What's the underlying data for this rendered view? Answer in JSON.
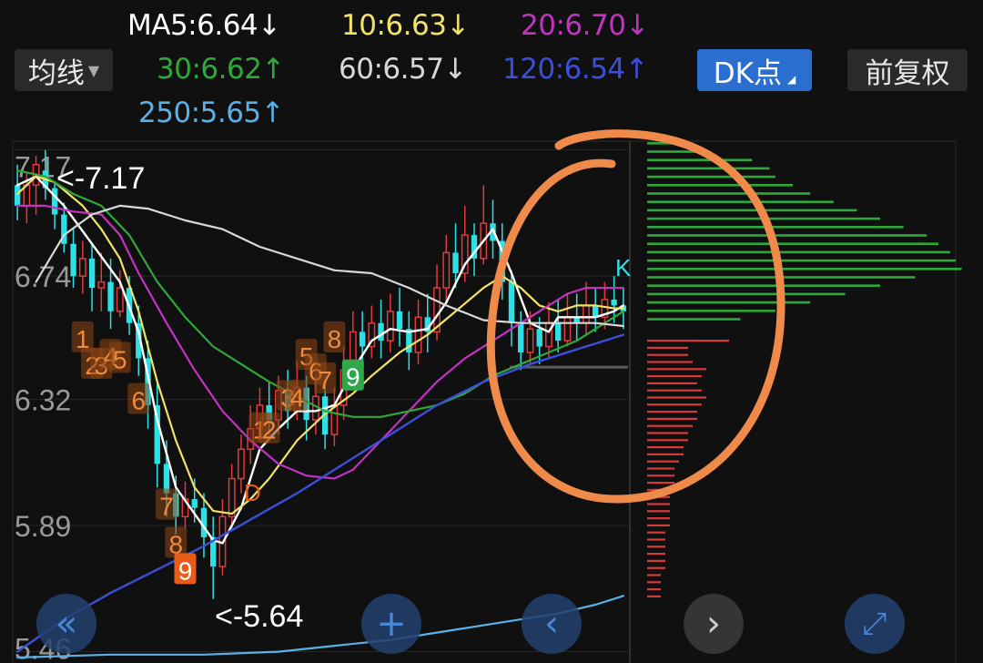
{
  "header": {
    "ma_button": "均线",
    "dk_button": "DK点",
    "fq_button": "前复权",
    "ma_items": [
      {
        "text": "MA5:6.64↓",
        "color": "#ffffff"
      },
      {
        "text": "10:6.63↓",
        "color": "#f2e266"
      },
      {
        "text": "20:6.70↓",
        "color": "#c233c2"
      },
      {
        "text": "30:6.62↑",
        "color": "#2ea83a"
      },
      {
        "text": "60:6.57↓",
        "color": "#d8d8d8"
      },
      {
        "text": "120:6.54↑",
        "color": "#3b4fd8"
      },
      {
        "text": "250:5.65↑",
        "color": "#5ab0e8"
      }
    ]
  },
  "chart_data": {
    "type": "candlestick",
    "y_tick_labels": [
      "7.17",
      "6.74",
      "6.32",
      "5.89",
      "5.46"
    ],
    "ylim": [
      5.44,
      7.2
    ],
    "annotations": {
      "high": "<-7.17",
      "low": "<-5.64",
      "d_marker": "D",
      "k_marker": "K"
    },
    "td_sequence": {
      "sell": [
        {
          "label": "1",
          "i": 7,
          "y": 6.53
        },
        {
          "label": "2",
          "i": 8,
          "y": 6.44
        },
        {
          "label": "3",
          "i": 9,
          "y": 6.44
        },
        {
          "label": "4",
          "i": 10,
          "y": 6.47
        },
        {
          "label": "5",
          "i": 11,
          "y": 6.46
        },
        {
          "label": "6",
          "i": 13,
          "y": 6.32
        },
        {
          "label": "7",
          "i": 16,
          "y": 5.96
        },
        {
          "label": "8",
          "i": 17,
          "y": 5.83
        },
        {
          "label": "9",
          "i": 18,
          "y": 5.74
        }
      ],
      "buy": [
        {
          "label": "1",
          "i": 26,
          "y": 6.22
        },
        {
          "label": "2",
          "i": 27,
          "y": 6.22
        },
        {
          "label": "3",
          "i": 29,
          "y": 6.33
        },
        {
          "label": "4",
          "i": 30,
          "y": 6.33
        },
        {
          "label": "5",
          "i": 31,
          "y": 6.47
        },
        {
          "label": "6",
          "i": 32,
          "y": 6.42
        },
        {
          "label": "7",
          "i": 33,
          "y": 6.39
        },
        {
          "label": "8",
          "i": 34,
          "y": 6.53
        },
        {
          "label": "9",
          "i": 36,
          "y": 6.4
        }
      ]
    },
    "candles": [
      [
        7.05,
        6.98,
        7.12,
        6.93
      ],
      [
        6.98,
        7.05,
        7.09,
        6.92
      ],
      [
        7.05,
        7.12,
        7.15,
        6.95
      ],
      [
        7.1,
        7.04,
        7.17,
        7.0
      ],
      [
        7.04,
        6.95,
        7.06,
        6.9
      ],
      [
        6.95,
        6.85,
        6.99,
        6.82
      ],
      [
        6.85,
        6.74,
        6.9,
        6.7
      ],
      [
        6.74,
        6.8,
        6.86,
        6.68
      ],
      [
        6.8,
        6.7,
        6.85,
        6.62
      ],
      [
        6.7,
        6.72,
        6.82,
        6.62
      ],
      [
        6.72,
        6.62,
        6.8,
        6.56
      ],
      [
        6.62,
        6.7,
        6.76,
        6.6
      ],
      [
        6.7,
        6.58,
        6.74,
        6.54
      ],
      [
        6.58,
        6.46,
        6.64,
        6.4
      ],
      [
        6.46,
        6.3,
        6.52,
        6.22
      ],
      [
        6.3,
        6.1,
        6.38,
        6.02
      ],
      [
        6.1,
        6.0,
        6.18,
        5.92
      ],
      [
        6.0,
        5.92,
        6.06,
        5.86
      ],
      [
        5.92,
        5.98,
        6.04,
        5.88
      ],
      [
        5.98,
        5.95,
        6.05,
        5.9
      ],
      [
        5.95,
        5.85,
        6.0,
        5.78
      ],
      [
        5.85,
        5.75,
        5.92,
        5.64
      ],
      [
        5.75,
        5.92,
        5.98,
        5.72
      ],
      [
        5.92,
        6.05,
        6.1,
        5.88
      ],
      [
        6.05,
        6.15,
        6.2,
        6.0
      ],
      [
        6.15,
        6.22,
        6.3,
        6.1
      ],
      [
        6.22,
        6.3,
        6.36,
        6.18
      ],
      [
        6.3,
        6.25,
        6.38,
        6.2
      ],
      [
        6.25,
        6.35,
        6.4,
        6.2
      ],
      [
        6.35,
        6.28,
        6.42,
        6.22
      ],
      [
        6.28,
        6.36,
        6.45,
        6.25
      ],
      [
        6.36,
        6.25,
        6.4,
        6.18
      ],
      [
        6.25,
        6.33,
        6.4,
        6.2
      ],
      [
        6.33,
        6.2,
        6.37,
        6.15
      ],
      [
        6.2,
        6.3,
        6.36,
        6.16
      ],
      [
        6.3,
        6.42,
        6.5,
        6.25
      ],
      [
        6.42,
        6.55,
        6.62,
        6.38
      ],
      [
        6.55,
        6.5,
        6.62,
        6.45
      ],
      [
        6.5,
        6.58,
        6.64,
        6.46
      ],
      [
        6.58,
        6.52,
        6.66,
        6.46
      ],
      [
        6.52,
        6.62,
        6.68,
        6.48
      ],
      [
        6.62,
        6.56,
        6.7,
        6.5
      ],
      [
        6.56,
        6.48,
        6.62,
        6.42
      ],
      [
        6.48,
        6.6,
        6.66,
        6.44
      ],
      [
        6.6,
        6.55,
        6.68,
        6.48
      ],
      [
        6.55,
        6.7,
        6.78,
        6.52
      ],
      [
        6.7,
        6.82,
        6.88,
        6.65
      ],
      [
        6.82,
        6.75,
        6.92,
        6.7
      ],
      [
        6.75,
        6.88,
        6.98,
        6.72
      ],
      [
        6.88,
        6.8,
        6.92,
        6.74
      ],
      [
        6.8,
        6.92,
        7.05,
        6.78
      ],
      [
        6.92,
        6.86,
        7.0,
        6.8
      ],
      [
        6.86,
        6.72,
        6.92,
        6.66
      ],
      [
        6.72,
        6.58,
        6.76,
        6.5
      ],
      [
        6.58,
        6.48,
        6.62,
        6.42
      ],
      [
        6.48,
        6.56,
        6.62,
        6.44
      ],
      [
        6.56,
        6.5,
        6.6,
        6.44
      ],
      [
        6.5,
        6.58,
        6.65,
        6.46
      ],
      [
        6.58,
        6.52,
        6.66,
        6.48
      ],
      [
        6.52,
        6.6,
        6.68,
        6.5
      ],
      [
        6.6,
        6.58,
        6.68,
        6.52
      ],
      [
        6.58,
        6.64,
        6.72,
        6.54
      ],
      [
        6.64,
        6.6,
        6.7,
        6.55
      ],
      [
        6.6,
        6.66,
        6.72,
        6.56
      ],
      [
        6.66,
        6.64,
        6.74,
        6.58
      ],
      [
        6.64,
        6.62,
        6.7,
        6.56
      ]
    ],
    "ma_lines": [
      {
        "color": "#ffffff",
        "width": 2.4,
        "points": [
          [
            0,
            7.05
          ],
          [
            2,
            7.08
          ],
          [
            5,
            6.98
          ],
          [
            8,
            6.85
          ],
          [
            11,
            6.72
          ],
          [
            13,
            6.55
          ],
          [
            15,
            6.25
          ],
          [
            17,
            6.02
          ],
          [
            19,
            5.93
          ],
          [
            21,
            5.84
          ],
          [
            22,
            5.83
          ],
          [
            24,
            5.95
          ],
          [
            26,
            6.15
          ],
          [
            28,
            6.22
          ],
          [
            30,
            6.28
          ],
          [
            32,
            6.28
          ],
          [
            34,
            6.3
          ],
          [
            36,
            6.42
          ],
          [
            38,
            6.52
          ],
          [
            40,
            6.56
          ],
          [
            42,
            6.55
          ],
          [
            44,
            6.56
          ],
          [
            46,
            6.65
          ],
          [
            48,
            6.78
          ],
          [
            50,
            6.86
          ],
          [
            51,
            6.9
          ],
          [
            53,
            6.75
          ],
          [
            55,
            6.58
          ],
          [
            57,
            6.55
          ],
          [
            58,
            6.6
          ],
          [
            60,
            6.6
          ],
          [
            62,
            6.6
          ],
          [
            64,
            6.62
          ],
          [
            65,
            6.64
          ]
        ]
      },
      {
        "color": "#f2e266",
        "width": 2.2,
        "points": [
          [
            0,
            7.02
          ],
          [
            2,
            7.08
          ],
          [
            4,
            7.06
          ],
          [
            7,
            6.98
          ],
          [
            9,
            6.9
          ],
          [
            11,
            6.8
          ],
          [
            13,
            6.62
          ],
          [
            15,
            6.38
          ],
          [
            17,
            6.18
          ],
          [
            19,
            6.02
          ],
          [
            21,
            5.94
          ],
          [
            23,
            5.93
          ],
          [
            25,
            5.98
          ],
          [
            27,
            6.05
          ],
          [
            30,
            6.18
          ],
          [
            33,
            6.27
          ],
          [
            36,
            6.34
          ],
          [
            38,
            6.4
          ],
          [
            41,
            6.48
          ],
          [
            44,
            6.54
          ],
          [
            47,
            6.62
          ],
          [
            50,
            6.7
          ],
          [
            52,
            6.74
          ],
          [
            54,
            6.7
          ],
          [
            56,
            6.64
          ],
          [
            58,
            6.62
          ],
          [
            60,
            6.64
          ],
          [
            62,
            6.64
          ],
          [
            64,
            6.63
          ],
          [
            65,
            6.63
          ]
        ]
      },
      {
        "color": "#c233c2",
        "width": 2.2,
        "points": [
          [
            0,
            6.98
          ],
          [
            3,
            6.98
          ],
          [
            6,
            6.96
          ],
          [
            9,
            6.95
          ],
          [
            11,
            6.88
          ],
          [
            13,
            6.75
          ],
          [
            16,
            6.58
          ],
          [
            19,
            6.42
          ],
          [
            22,
            6.28
          ],
          [
            25,
            6.18
          ],
          [
            28,
            6.1
          ],
          [
            31,
            6.06
          ],
          [
            34,
            6.05
          ],
          [
            36,
            6.08
          ],
          [
            39,
            6.18
          ],
          [
            42,
            6.28
          ],
          [
            45,
            6.38
          ],
          [
            48,
            6.46
          ],
          [
            51,
            6.52
          ],
          [
            54,
            6.58
          ],
          [
            57,
            6.64
          ],
          [
            59,
            6.68
          ],
          [
            61,
            6.7
          ],
          [
            63,
            6.7
          ],
          [
            65,
            6.7
          ]
        ]
      },
      {
        "color": "#2ea83a",
        "width": 2.2,
        "points": [
          [
            0,
            7.1
          ],
          [
            3,
            7.08
          ],
          [
            6,
            7.02
          ],
          [
            9,
            6.98
          ],
          [
            12,
            6.88
          ],
          [
            15,
            6.72
          ],
          [
            18,
            6.6
          ],
          [
            21,
            6.5
          ],
          [
            24,
            6.44
          ],
          [
            27,
            6.38
          ],
          [
            30,
            6.33
          ],
          [
            33,
            6.28
          ],
          [
            36,
            6.26
          ],
          [
            39,
            6.26
          ],
          [
            42,
            6.28
          ],
          [
            45,
            6.3
          ],
          [
            48,
            6.34
          ],
          [
            51,
            6.4
          ],
          [
            54,
            6.44
          ],
          [
            57,
            6.48
          ],
          [
            60,
            6.52
          ],
          [
            62,
            6.56
          ],
          [
            64,
            6.6
          ],
          [
            65,
            6.62
          ]
        ]
      },
      {
        "color": "#d8d8d8",
        "width": 2.2,
        "points": [
          [
            2,
            6.72
          ],
          [
            5,
            6.88
          ],
          [
            8,
            6.95
          ],
          [
            11,
            6.98
          ],
          [
            14,
            6.97
          ],
          [
            18,
            6.93
          ],
          [
            22,
            6.9
          ],
          [
            26,
            6.84
          ],
          [
            30,
            6.8
          ],
          [
            34,
            6.76
          ],
          [
            38,
            6.75
          ],
          [
            42,
            6.7
          ],
          [
            46,
            6.64
          ],
          [
            50,
            6.59
          ],
          [
            54,
            6.58
          ],
          [
            58,
            6.58
          ],
          [
            62,
            6.58
          ],
          [
            65,
            6.57
          ]
        ]
      },
      {
        "color": "#3b4fd8",
        "width": 2.4,
        "points": [
          [
            0,
            5.46
          ],
          [
            5,
            5.57
          ],
          [
            10,
            5.66
          ],
          [
            15,
            5.74
          ],
          [
            20,
            5.82
          ],
          [
            25,
            5.91
          ],
          [
            30,
            6.0
          ],
          [
            35,
            6.1
          ],
          [
            40,
            6.2
          ],
          [
            45,
            6.3
          ],
          [
            50,
            6.38
          ],
          [
            55,
            6.44
          ],
          [
            60,
            6.49
          ],
          [
            65,
            6.54
          ]
        ]
      },
      {
        "color": "#5ab0e8",
        "width": 2.2,
        "points": [
          [
            0,
            5.44
          ],
          [
            10,
            5.45
          ],
          [
            20,
            5.45
          ],
          [
            28,
            5.46
          ],
          [
            34,
            5.48
          ],
          [
            40,
            5.5
          ],
          [
            46,
            5.53
          ],
          [
            52,
            5.56
          ],
          [
            58,
            5.59
          ],
          [
            62,
            5.62
          ],
          [
            65,
            5.65
          ]
        ]
      }
    ],
    "volume_profile_green": [
      5,
      10,
      18,
      21,
      22,
      25,
      28,
      32,
      36,
      40,
      44,
      48,
      50,
      52,
      53,
      54,
      46,
      40,
      34,
      28,
      22,
      16
    ],
    "volume_profile_red": [
      18,
      9,
      9,
      10,
      13,
      12,
      11,
      12,
      13,
      12,
      11,
      11,
      10,
      9,
      9,
      8,
      8,
      7,
      6,
      6,
      6,
      5,
      5,
      5,
      5,
      5,
      5,
      4,
      4,
      4,
      4,
      4,
      4,
      3,
      3,
      3,
      3
    ]
  },
  "nav": {
    "rewind_icon": "«",
    "zoom_in_icon": "+",
    "prev_icon": "‹",
    "next_icon": "›",
    "fullscreen_icon": "⤢"
  }
}
